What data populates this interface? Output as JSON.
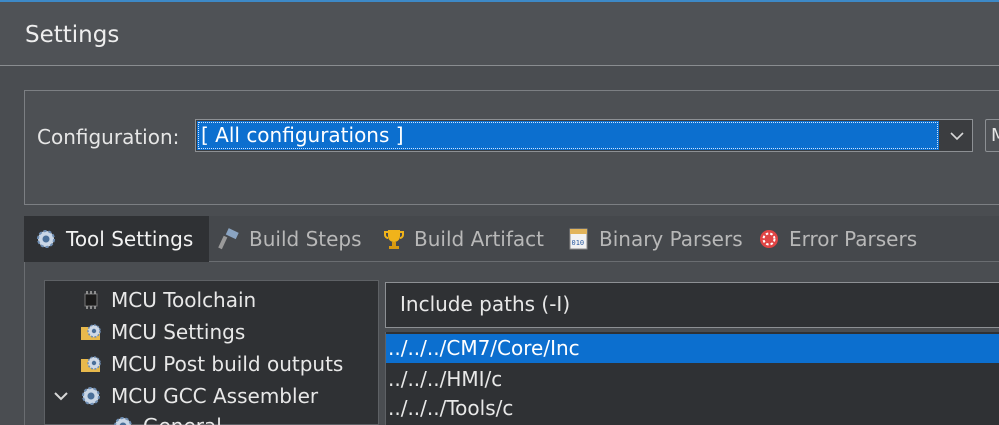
{
  "window": {
    "title": "Settings"
  },
  "configuration": {
    "label": "Configuration:",
    "selected": "[ All configurations ]",
    "manage_button_label": "M"
  },
  "tabs": [
    {
      "label": "Tool Settings",
      "icon": "gear-icon",
      "active": true
    },
    {
      "label": "Build Steps",
      "icon": "hammer-icon",
      "active": false
    },
    {
      "label": "Build Artifact",
      "icon": "trophy-icon",
      "active": false
    },
    {
      "label": "Binary Parsers",
      "icon": "binary-file-icon",
      "active": false
    },
    {
      "label": "Error Parsers",
      "icon": "error-icon",
      "active": false
    }
  ],
  "tree": {
    "items": [
      {
        "label": "MCU Toolchain",
        "icon": "chip-icon"
      },
      {
        "label": "MCU Settings",
        "icon": "folder-gear-icon"
      },
      {
        "label": "MCU Post build outputs",
        "icon": "folder-gear-icon"
      },
      {
        "label": "MCU GCC Assembler",
        "icon": "gear-icon",
        "expanded": true
      },
      {
        "label": "General",
        "icon": "gear-icon"
      }
    ]
  },
  "include_panel": {
    "header": "Include paths (-I)",
    "paths": [
      {
        "value": "../../../CM7/Core/Inc",
        "selected": true
      },
      {
        "value": "../../../HMI/c",
        "selected": false
      },
      {
        "value": "../../../Tools/c",
        "selected": false
      }
    ]
  },
  "colors": {
    "accent": "#0c6fcf",
    "background": "#4a4d51",
    "panel": "#2f3134"
  }
}
